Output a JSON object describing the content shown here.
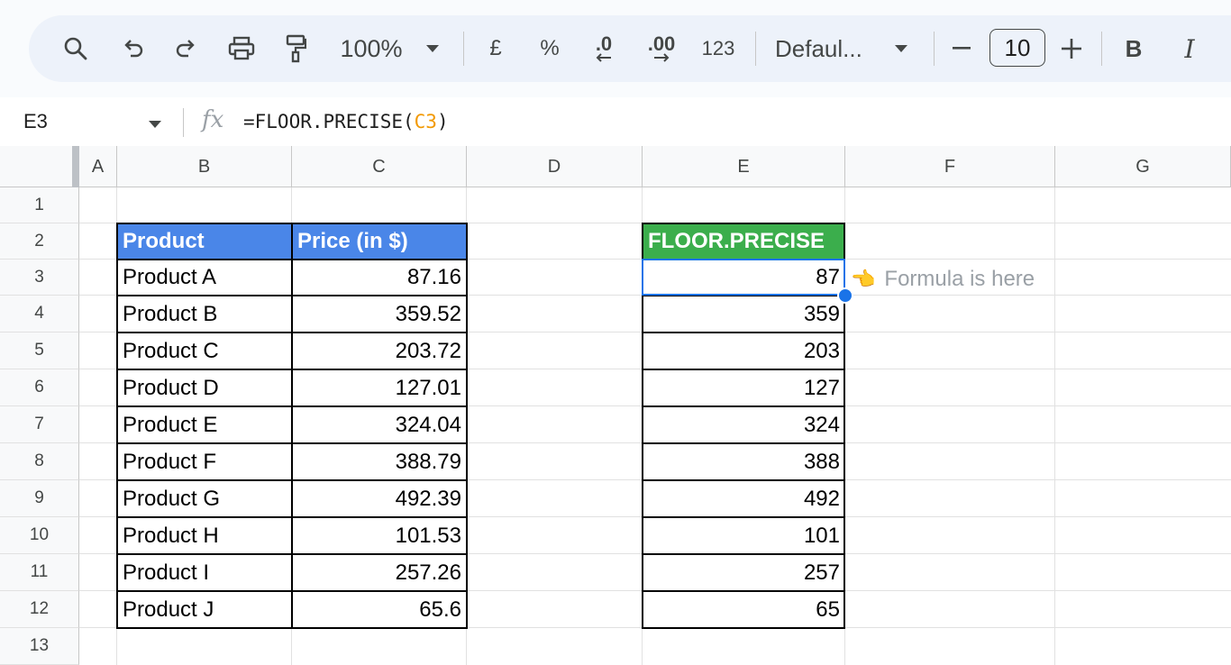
{
  "toolbar": {
    "zoom": "100%",
    "currency": "£",
    "percent": "%",
    "decrease_decimal": ".0",
    "increase_decimal": ".00",
    "number_format": "123",
    "font": "Defaul...",
    "font_size": "10",
    "bold": "B",
    "italic": "I"
  },
  "formula_bar": {
    "name_box": "E3",
    "fx": "fx",
    "formula_prefix": "=FLOOR.PRECISE(",
    "formula_ref": "C3",
    "formula_suffix": ")"
  },
  "columns": [
    "A",
    "B",
    "C",
    "D",
    "E",
    "F",
    "G"
  ],
  "rows": [
    "1",
    "2",
    "3",
    "4",
    "5",
    "6",
    "7",
    "8",
    "9",
    "10",
    "11",
    "12",
    "13"
  ],
  "table": {
    "header_product": "Product",
    "header_price": "Price (in $)",
    "header_floor": "FLOOR.PRECISE",
    "products": [
      "Product A",
      "Product B",
      "Product C",
      "Product D",
      "Product E",
      "Product F",
      "Product G",
      "Product H",
      "Product I",
      "Product J"
    ],
    "prices": [
      "87.16",
      "359.52",
      "203.72",
      "127.01",
      "324.04",
      "388.79",
      "492.39",
      "101.53",
      "257.26",
      "65.6"
    ],
    "floors": [
      "87",
      "359",
      "203",
      "127",
      "324",
      "388",
      "492",
      "101",
      "257",
      "65"
    ]
  },
  "note": {
    "hand_icon": "👈",
    "text": "Formula is here"
  },
  "colors": {
    "header_blue": "#4a86e8",
    "header_green": "#3bae4c",
    "selection": "#1a73e8"
  }
}
